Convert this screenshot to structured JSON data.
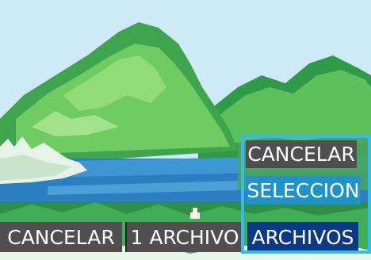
{
  "menu": {
    "cancel_label": "CANCELAR",
    "selection_label": "SELECCION",
    "files_label": "ARCHIVOS"
  },
  "bottom_bar": {
    "cancel_label": "CANCELAR",
    "one_file_label": "1 ARCHIVO",
    "files_label": "ARCHIVOS"
  },
  "colors": {
    "button_gray": "#4f4f4f",
    "highlight_cyan": "#1f93c9",
    "selected_blue": "#0a3a86",
    "focus_frame": "#37b9ee"
  }
}
